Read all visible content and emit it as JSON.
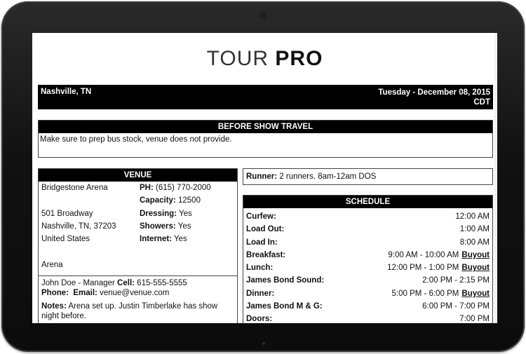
{
  "app": {
    "logo_light": "TOUR ",
    "logo_bold": "PRO"
  },
  "header": {
    "city": "Nashville, TN",
    "date": "Tuesday - December 08, 2015",
    "timezone": "CDT"
  },
  "travel": {
    "title": "BEFORE SHOW TRAVEL",
    "note": "Make sure to prep bus stock, venue does not provide."
  },
  "venue": {
    "title": "VENUE",
    "name": "Bridgestone Arena",
    "address": "501 Broadway",
    "city_line": "Nashville, TN, 37203",
    "country": "United States",
    "type": "Arena",
    "phone_label": "PH:",
    "phone": "(615) 770-2000",
    "capacity_label": "Capacity:",
    "capacity": "12500",
    "dressing_label": "Dressing:",
    "dressing": "Yes",
    "showers_label": "Showers:",
    "showers": "Yes",
    "internet_label": "Internet:",
    "internet": "Yes",
    "contact_name": "John Doe - Manager",
    "cell_label": "Cell:",
    "cell": "615-555-5555",
    "phone2_label": "Phone:",
    "email_label": "Email:",
    "email": "venue@venue.com",
    "notes_label": "Notes:",
    "notes": "Arena set up. Justin Timberlake has show night before."
  },
  "runner": {
    "label": "Runner:",
    "value": "2 runners. 8am-12am DOS"
  },
  "schedule": {
    "title": "SCHEDULE",
    "buyout_label": "Buyout",
    "items": [
      {
        "label": "Curfew:",
        "value": "12:00 AM"
      },
      {
        "label": "Load Out:",
        "value": "1:00 AM"
      },
      {
        "label": "Load In:",
        "value": "8:00 AM"
      },
      {
        "label": "Breakfast:",
        "value": "9:00 AM - 10:00 AM"
      },
      {
        "label": "Lunch:",
        "value": "12:00 PM - 1:00 PM"
      },
      {
        "label": "James Bond Sound:",
        "value": "2:00 PM - 2:15 PM"
      },
      {
        "label": "Dinner:",
        "value": "5:00 PM - 6:00 PM"
      },
      {
        "label": "James Bond M & G:",
        "value": "6:00 PM - 7:00 PM"
      },
      {
        "label": "Doors:",
        "value": "7:00 PM"
      }
    ]
  }
}
